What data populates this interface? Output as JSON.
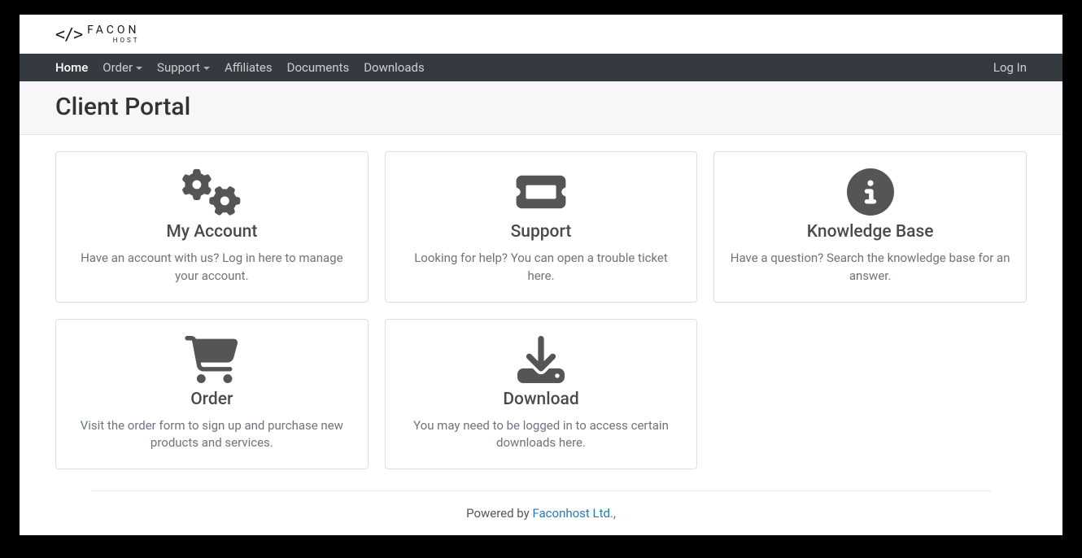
{
  "logo": {
    "brand": "FACON",
    "sub": "HOST"
  },
  "nav": {
    "items": [
      {
        "label": "Home",
        "active": true,
        "dropdown": false
      },
      {
        "label": "Order",
        "active": false,
        "dropdown": true
      },
      {
        "label": "Support",
        "active": false,
        "dropdown": true
      },
      {
        "label": "Affiliates",
        "active": false,
        "dropdown": false
      },
      {
        "label": "Documents",
        "active": false,
        "dropdown": false
      },
      {
        "label": "Downloads",
        "active": false,
        "dropdown": false
      }
    ],
    "login": "Log In"
  },
  "header": {
    "title": "Client Portal"
  },
  "cards": [
    {
      "title": "My Account",
      "desc": "Have an account with us? Log in here to manage your account.",
      "icon": "gears-icon"
    },
    {
      "title": "Support",
      "desc": "Looking for help? You can open a trouble ticket here.",
      "icon": "ticket-icon"
    },
    {
      "title": "Knowledge Base",
      "desc": "Have a question? Search the knowledge base for an answer.",
      "icon": "info-icon"
    },
    {
      "title": "Order",
      "desc": "Visit the order form to sign up and purchase new products and services.",
      "icon": "cart-icon"
    },
    {
      "title": "Download",
      "desc": "You may need to be logged in to access certain downloads here.",
      "icon": "download-icon"
    }
  ],
  "footer": {
    "prefix": "Powered by ",
    "link": "Faconhost Ltd.,"
  }
}
